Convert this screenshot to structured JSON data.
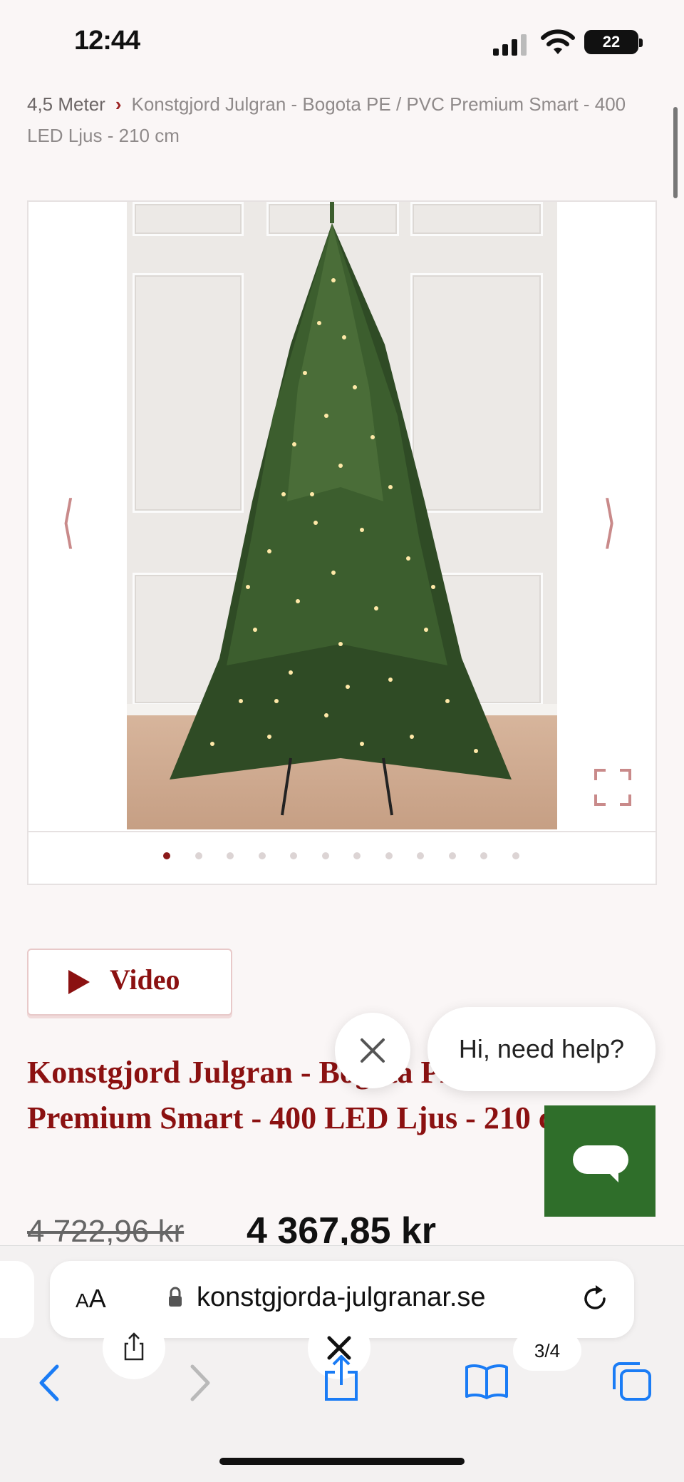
{
  "status_bar": {
    "time": "12:44",
    "battery": "22"
  },
  "breadcrumb": {
    "first": "4,5 Meter",
    "current": "Konstgjord Julgran - Bogota PE / PVC Premium Smart - 400 LED Ljus - 210 cm"
  },
  "gallery": {
    "slide_count": 12,
    "active_slide": 1
  },
  "video_button": {
    "label": "Video"
  },
  "product": {
    "title": "Konstgjord Julgran - Bogota PE / PVC Premium Smart - 400 LED Ljus - 210 cm",
    "old_price": "4 722,96 kr",
    "new_price": "4 367,85 kr"
  },
  "chat": {
    "prompt": "Hi, need help?"
  },
  "browser": {
    "aa_label_big": "A",
    "aa_label_small": "A",
    "url": "konstgjorda-julgranar.se",
    "tab_counter": "3/4"
  },
  "colors": {
    "brand": "#8b1111",
    "chat_green": "#2f6e2a",
    "ios_blue": "#1a7cf5"
  }
}
